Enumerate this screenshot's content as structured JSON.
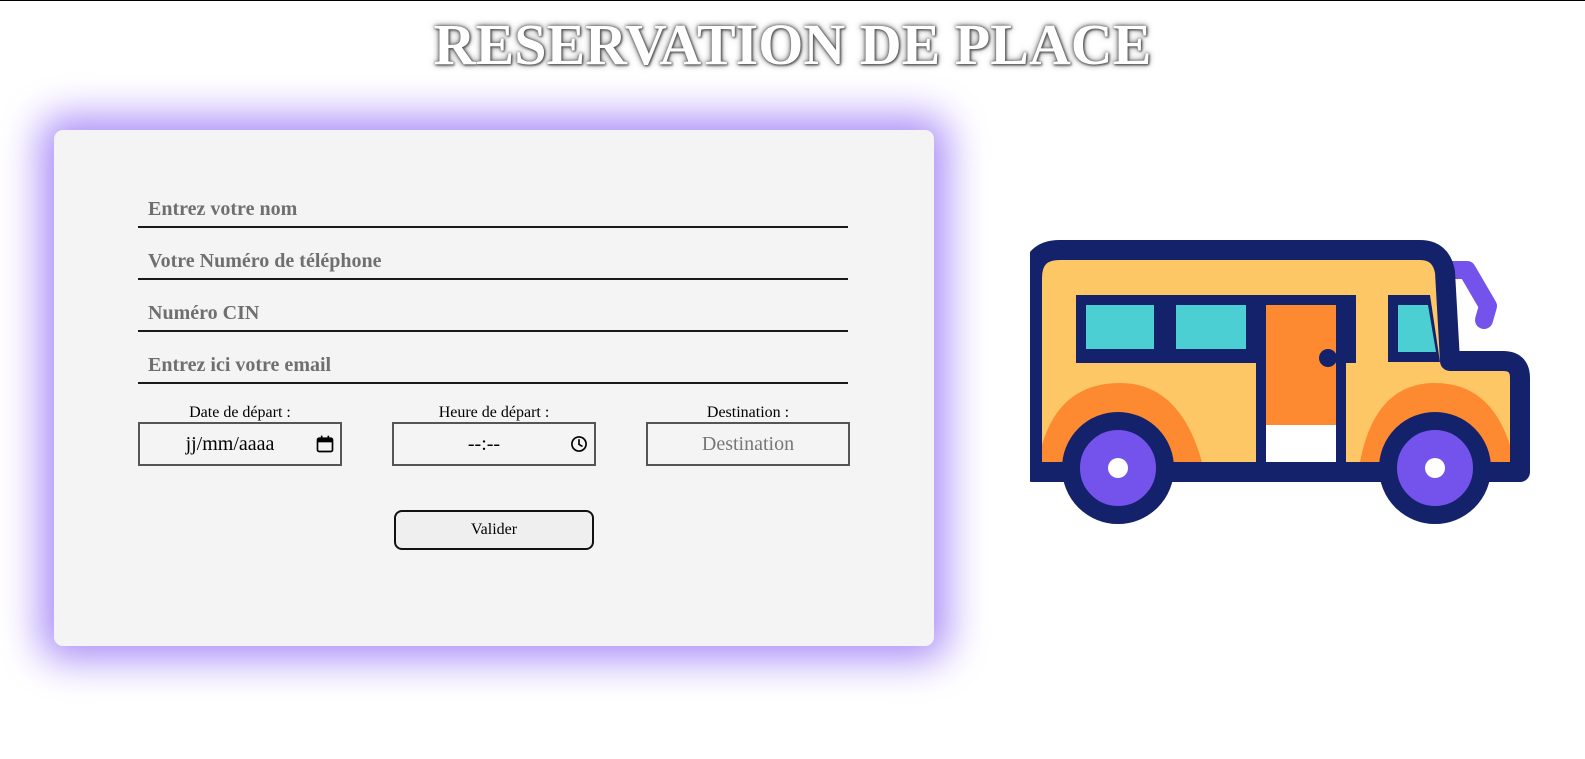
{
  "header": {
    "title": "RESERVATION DE PLACE"
  },
  "form": {
    "name_placeholder": "Entrez votre nom",
    "phone_placeholder": "Votre Numéro de téléphone",
    "cin_placeholder": "Numéro CIN",
    "email_placeholder": "Entrez ici votre email",
    "date": {
      "label": "Date de départ :",
      "value": "jj/mm/aaaa",
      "icon": "calendar-icon"
    },
    "time": {
      "label": "Heure de départ :",
      "value": "--:--",
      "icon": "clock-icon"
    },
    "destination": {
      "label": "Destination :",
      "placeholder": "Destination"
    },
    "submit_label": "Valider"
  },
  "illustration": {
    "icon": "bus-icon"
  },
  "colors": {
    "card_background": "#f4f4f4",
    "card_glow": "#ab8ff7",
    "bus_outline": "#14216b",
    "bus_body": "#fec766",
    "bus_accent": "#fd8a30",
    "bus_window": "#4bcfd3",
    "bus_wheel": "#7452ec"
  }
}
